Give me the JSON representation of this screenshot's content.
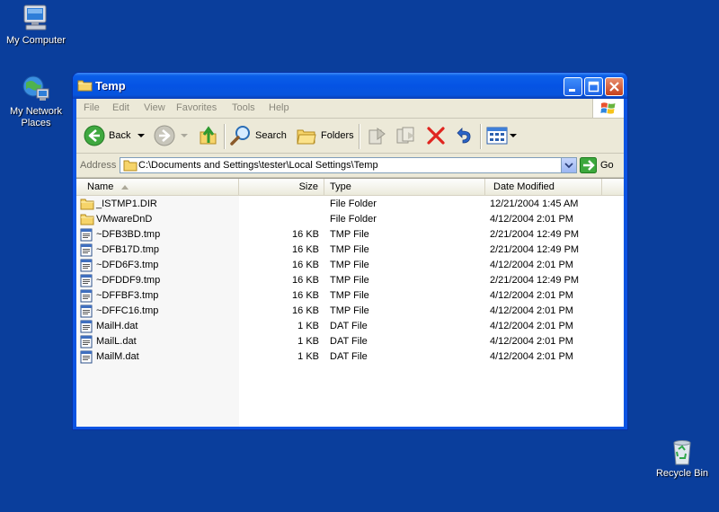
{
  "desktop": {
    "icons": [
      {
        "label": "My Computer"
      },
      {
        "label": "My Network Places"
      },
      {
        "label": "Recycle Bin"
      }
    ]
  },
  "window": {
    "title": "Temp",
    "menu": [
      "File",
      "Edit",
      "View",
      "Favorites",
      "Tools",
      "Help"
    ],
    "toolbar": {
      "back_label": "Back",
      "search_label": "Search",
      "folders_label": "Folders"
    },
    "address": {
      "label": "Address",
      "value": "C:\\Documents and Settings\\tester\\Local Settings\\Temp",
      "go_label": "Go"
    },
    "columns": [
      "Name",
      "Size",
      "Type",
      "Date Modified"
    ],
    "files": [
      {
        "name": "_ISTMP1.DIR",
        "size": "",
        "type": "File Folder",
        "date": "12/21/2004 1:45 AM",
        "kind": "folder"
      },
      {
        "name": "VMwareDnD",
        "size": "",
        "type": "File Folder",
        "date": "4/12/2004 2:01 PM",
        "kind": "folder"
      },
      {
        "name": "~DFB3BD.tmp",
        "size": "16 KB",
        "type": "TMP File",
        "date": "2/21/2004 12:49 PM",
        "kind": "file"
      },
      {
        "name": "~DFB17D.tmp",
        "size": "16 KB",
        "type": "TMP File",
        "date": "2/21/2004 12:49 PM",
        "kind": "file"
      },
      {
        "name": "~DFD6F3.tmp",
        "size": "16 KB",
        "type": "TMP File",
        "date": "4/12/2004 2:01 PM",
        "kind": "file"
      },
      {
        "name": "~DFDDF9.tmp",
        "size": "16 KB",
        "type": "TMP File",
        "date": "2/21/2004 12:49 PM",
        "kind": "file"
      },
      {
        "name": "~DFFBF3.tmp",
        "size": "16 KB",
        "type": "TMP File",
        "date": "4/12/2004 2:01 PM",
        "kind": "file"
      },
      {
        "name": "~DFFC16.tmp",
        "size": "16 KB",
        "type": "TMP File",
        "date": "4/12/2004 2:01 PM",
        "kind": "file"
      },
      {
        "name": "MailH.dat",
        "size": "1 KB",
        "type": "DAT File",
        "date": "4/12/2004 2:01 PM",
        "kind": "file"
      },
      {
        "name": "MailL.dat",
        "size": "1 KB",
        "type": "DAT File",
        "date": "4/12/2004 2:01 PM",
        "kind": "file"
      },
      {
        "name": "MailM.dat",
        "size": "1 KB",
        "type": "DAT File",
        "date": "4/12/2004 2:01 PM",
        "kind": "file"
      }
    ]
  },
  "colors": {
    "desktop": "#0a3e9c",
    "titlebar": "#0553e4",
    "window_face": "#ece9d8"
  }
}
